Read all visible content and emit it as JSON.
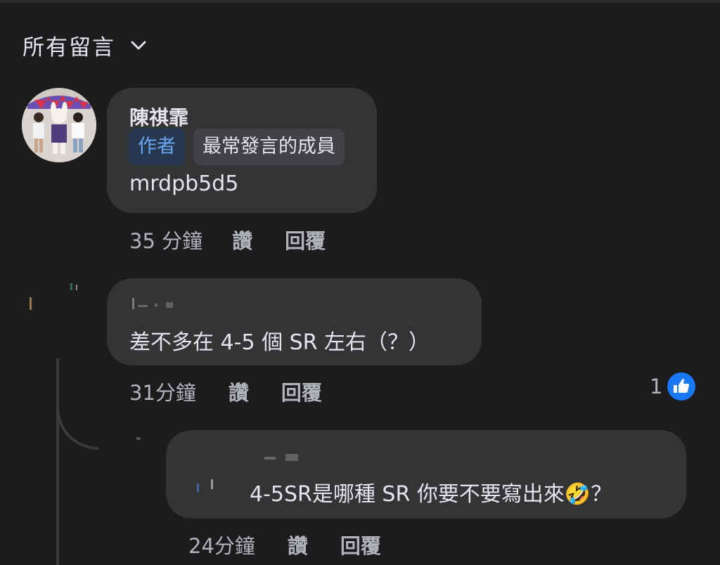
{
  "header": {
    "sort_label": "所有留言",
    "sort_icon": "chevron-down-icon"
  },
  "comments": [
    {
      "author": "陳祺霏",
      "badges": [
        "作者",
        "最常發言的成員"
      ],
      "text": "mrdpb5d5",
      "time": "35 分鐘",
      "like_label": "讚",
      "reply_label": "回覆"
    },
    {
      "text": "差不多在 4-5 個 SR 左右（？）",
      "time": "31分鐘",
      "like_label": "讚",
      "reply_label": "回覆",
      "reaction_count": "1",
      "reaction_icon": "like-thumbs-up-icon"
    },
    {
      "text": "4-5SR是哪種 SR 你要不要寫出來🤣？",
      "time": "24分鐘",
      "like_label": "讚",
      "reply_label": "回覆"
    }
  ],
  "colors": {
    "background": "#1c1c1e",
    "bubble": "#333436",
    "author_badge_bg": "#263850",
    "author_badge_text": "#6ba4ef",
    "like_blue": "#1877f2"
  }
}
